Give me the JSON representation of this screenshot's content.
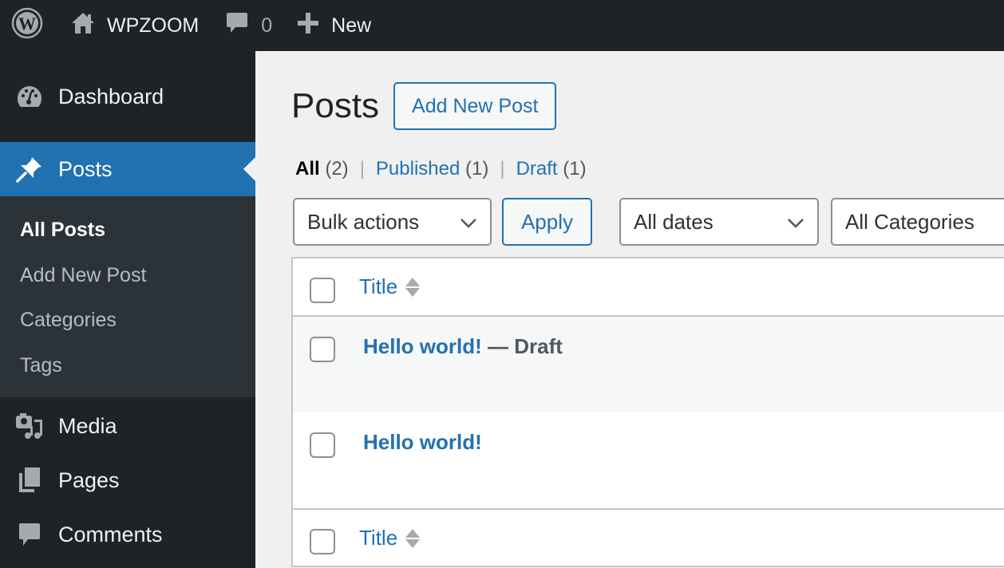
{
  "adminbar": {
    "wp_logo_icon": "wordpress-logo-icon",
    "site_name": "WPZOOM",
    "site_icon": "home-icon",
    "comments_icon": "comment-bubble-icon",
    "comments_count": "0",
    "new_icon": "plus-icon",
    "new_label": "New"
  },
  "sidebar": {
    "items": [
      {
        "label": "Dashboard",
        "icon": "dashboard-gauge-icon"
      },
      {
        "label": "Posts",
        "icon": "pushpin-icon",
        "active": true
      },
      {
        "label": "Media",
        "icon": "media-camera-music-icon"
      },
      {
        "label": "Pages",
        "icon": "pages-icon"
      },
      {
        "label": "Comments",
        "icon": "comment-bubble-icon"
      }
    ],
    "submenu": [
      {
        "label": "All Posts",
        "current": true
      },
      {
        "label": "Add New Post"
      },
      {
        "label": "Categories"
      },
      {
        "label": "Tags"
      }
    ]
  },
  "main": {
    "title": "Posts",
    "add_new_label": "Add New Post",
    "views": [
      {
        "label": "All",
        "count": "(2)",
        "current": true
      },
      {
        "label": "Published",
        "count": "(1)"
      },
      {
        "label": "Draft",
        "count": "(1)"
      }
    ],
    "separator": "|",
    "bulk_actions": {
      "selected": "Bulk actions"
    },
    "apply_label": "Apply",
    "dates_filter": {
      "selected": "All dates"
    },
    "categories_filter": {
      "selected": "All Categories"
    },
    "table": {
      "column_title": "Title",
      "rows": [
        {
          "title": "Hello world!",
          "state": " — Draft"
        },
        {
          "title": "Hello world!",
          "state": ""
        }
      ]
    }
  },
  "colors": {
    "adminbar_bg": "#1d2327",
    "accent": "#2271b1",
    "submenu_bg": "#2c3338",
    "page_bg": "#f0f0f1"
  }
}
